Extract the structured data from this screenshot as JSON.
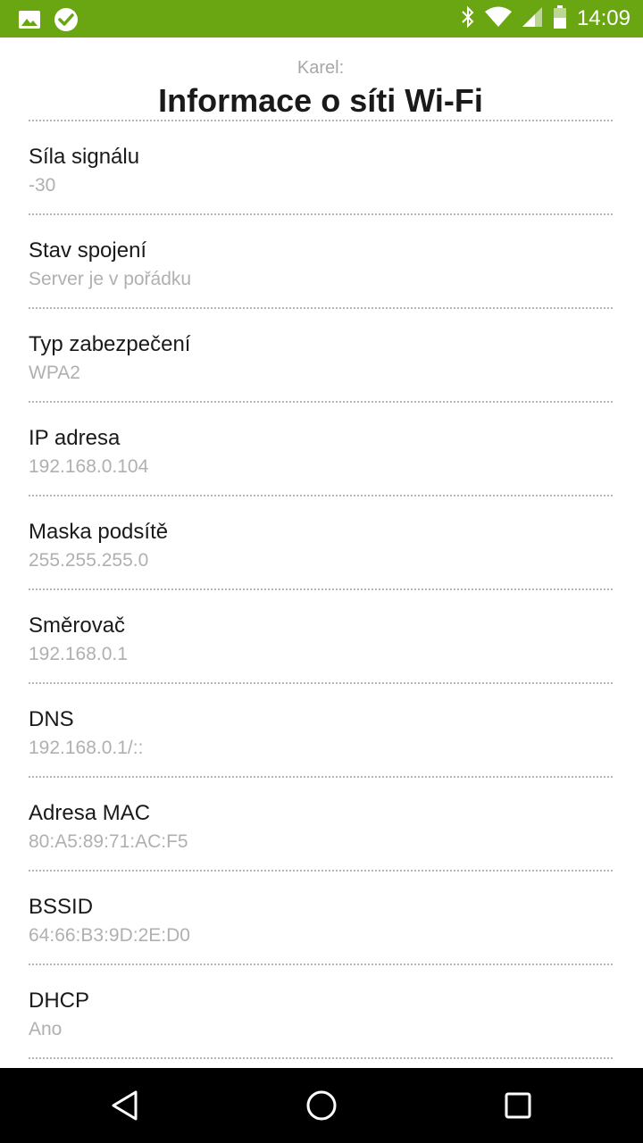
{
  "status_bar": {
    "time": "14:09",
    "left_icons": [
      "image-icon",
      "check-circle-icon"
    ],
    "right_icons": [
      "bluetooth-icon",
      "wifi-icon",
      "cell-signal-icon",
      "battery-icon"
    ],
    "bg_color": "#6aa611"
  },
  "header": {
    "subtitle": "Karel:",
    "title": "Informace o síti Wi-Fi"
  },
  "items": [
    {
      "label": "Síla signálu",
      "value": "-30"
    },
    {
      "label": "Stav spojení",
      "value": "Server je v pořádku"
    },
    {
      "label": "Typ zabezpečení",
      "value": "WPA2"
    },
    {
      "label": "IP adresa",
      "value": "192.168.0.104"
    },
    {
      "label": "Maska podsítě",
      "value": "255.255.255.0"
    },
    {
      "label": "Směrovač",
      "value": "192.168.0.1"
    },
    {
      "label": "DNS",
      "value": "192.168.0.1/::"
    },
    {
      "label": "Adresa MAC",
      "value": "80:A5:89:71:AC:F5"
    },
    {
      "label": "BSSID",
      "value": "64:66:B3:9D:2E:D0"
    },
    {
      "label": "DHCP",
      "value": "Ano"
    }
  ],
  "nav_bar": {
    "buttons": [
      "back-icon",
      "home-icon",
      "recents-icon"
    ]
  }
}
